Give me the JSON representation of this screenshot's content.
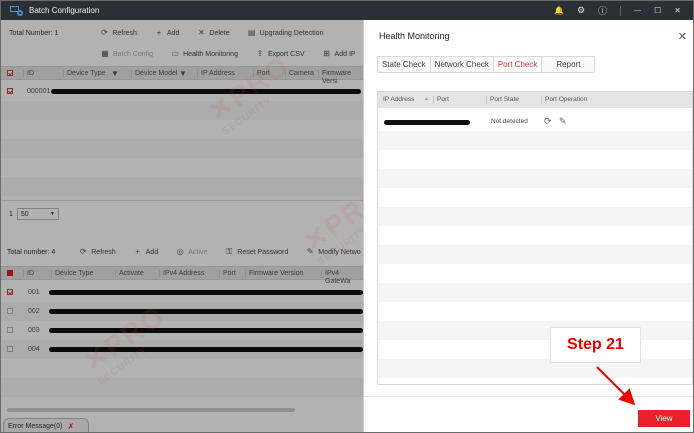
{
  "window": {
    "title": "Batch Configuration",
    "controls": {
      "bell": "🔔",
      "gear": "⚙",
      "info": "ⓘ",
      "minimize": "—",
      "maximize": "☐",
      "close": "✕"
    }
  },
  "upper_table": {
    "total_label": "Total Number: 1",
    "toolbar1": {
      "refresh": "Refresh",
      "add": "Add",
      "delete": "Delete",
      "upgrading": "Upgrading Detection"
    },
    "toolbar2": {
      "batch_config": "Batch Config",
      "health": "Health Monitoring",
      "export_csv": "Export CSV",
      "add_ip": "Add IP"
    },
    "columns": [
      "ID",
      "Device Type",
      "Device Model",
      "IP Address",
      "Port",
      "Camera",
      "Firmware Versi"
    ],
    "rows": [
      {
        "id": "000001"
      }
    ],
    "page_size": "50",
    "page_num": "1"
  },
  "lower_table": {
    "total_label": "Total number: 4",
    "toolbar": {
      "refresh": "Refresh",
      "add": "Add",
      "active": "Active",
      "reset_pw": "Reset Password",
      "modify": "Modify Netwo"
    },
    "columns": [
      "ID",
      "Device Type",
      "Activate",
      "IPv4 Address",
      "Port",
      "Firmware Version",
      "IPv4 GateWa"
    ],
    "rows": [
      {
        "id": "001"
      },
      {
        "id": "002"
      },
      {
        "id": "003"
      },
      {
        "id": "004"
      }
    ]
  },
  "error_tab": {
    "label": "Error Message(0)"
  },
  "panel": {
    "title": "Health Monitoring",
    "tabs": [
      "State Check",
      "Network Check",
      "Port Check",
      "Report"
    ],
    "columns": [
      "IP Address",
      "Port",
      "Port State",
      "Port Operation"
    ],
    "rows": [
      {
        "port_state": "Not detected"
      }
    ],
    "view_button": "View"
  },
  "annotation": {
    "step": "Step 21"
  },
  "watermark": {
    "brand": "PRO",
    "sub": "SECURITY"
  },
  "colors": {
    "accent": "#e8202a",
    "titlebar": "#2b2f36"
  }
}
